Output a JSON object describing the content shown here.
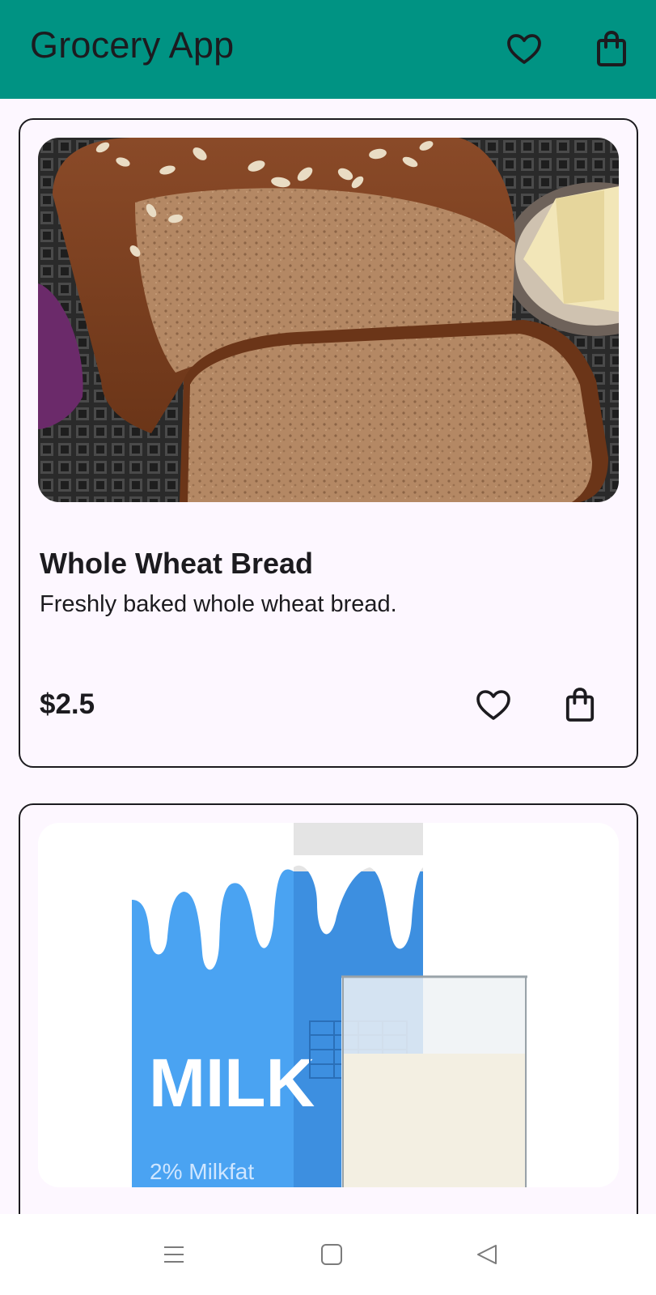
{
  "app_bar": {
    "title": "Grocery App",
    "favorites_icon": "heart-outline-icon",
    "cart_icon": "shopping-bag-icon",
    "background_color": "#009383"
  },
  "products": [
    {
      "name": "Whole Wheat Bread",
      "description": "Freshly baked whole wheat bread.",
      "price": "$2.5",
      "image": "bread-loaf-photo",
      "favorite_icon": "heart-outline-icon",
      "cart_icon": "shopping-bag-icon"
    },
    {
      "name": "",
      "description": "",
      "price": "",
      "image": "milk-carton-photo",
      "image_texts": {
        "carton_label": "MILK",
        "carton_sublabel": "2% Milkfat"
      }
    }
  ],
  "system_nav": {
    "recent_icon": "menu-lines-icon",
    "home_icon": "square-home-icon",
    "back_icon": "triangle-back-icon"
  }
}
